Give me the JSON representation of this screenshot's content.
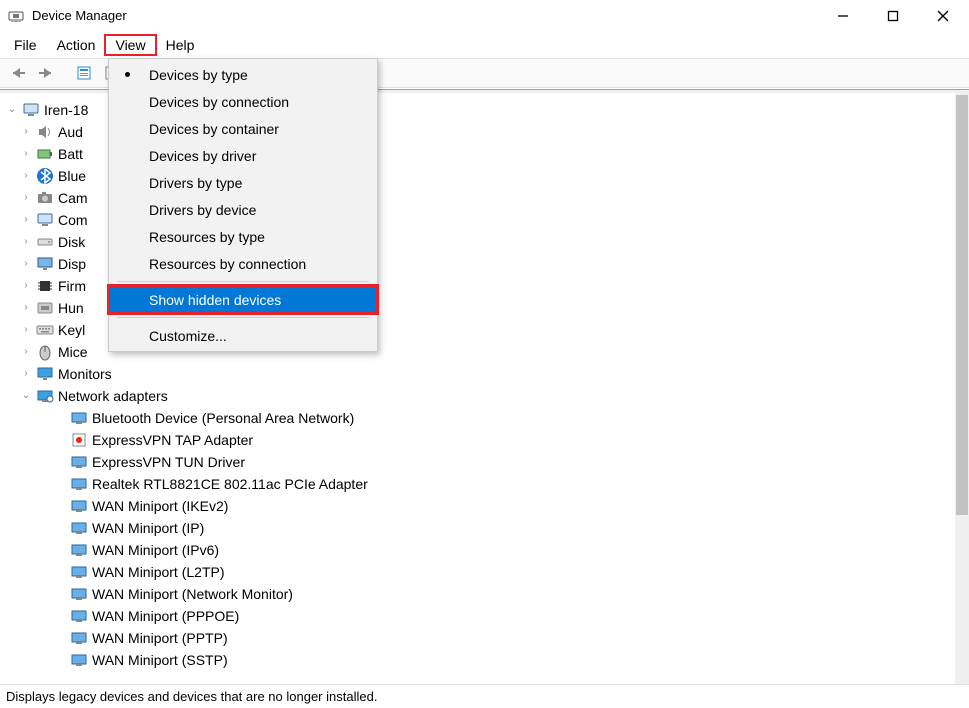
{
  "window": {
    "title": "Device Manager"
  },
  "menu": {
    "items": [
      "File",
      "Action",
      "View",
      "Help"
    ],
    "active": 2
  },
  "view_menu": {
    "items": [
      {
        "label": "Devices by type",
        "checked": true
      },
      {
        "label": "Devices by connection"
      },
      {
        "label": "Devices by container"
      },
      {
        "label": "Devices by driver"
      },
      {
        "label": "Drivers by type"
      },
      {
        "label": "Drivers by device"
      },
      {
        "label": "Resources by type"
      },
      {
        "label": "Resources by connection"
      },
      {
        "sep": true
      },
      {
        "label": "Show hidden devices",
        "selected": true
      },
      {
        "sep": true
      },
      {
        "label": "Customize..."
      }
    ]
  },
  "tree": {
    "root": "Iren-18",
    "categories": [
      {
        "label": "Aud",
        "icon": "speaker"
      },
      {
        "label": "Batt",
        "icon": "battery"
      },
      {
        "label": "Blue",
        "icon": "bluetooth"
      },
      {
        "label": "Cam",
        "icon": "camera"
      },
      {
        "label": "Com",
        "icon": "computer"
      },
      {
        "label": "Disk",
        "icon": "disk"
      },
      {
        "label": "Disp",
        "icon": "display"
      },
      {
        "label": "Firm",
        "icon": "chip"
      },
      {
        "label": "Hun",
        "icon": "hid"
      },
      {
        "label": "Keyl",
        "icon": "keyboard"
      },
      {
        "label": "Mice",
        "icon": "mouse"
      },
      {
        "label": "Monitors",
        "icon": "monitor"
      },
      {
        "label": "Network adapters",
        "icon": "network",
        "expanded": true
      }
    ],
    "network_children": [
      "Bluetooth Device (Personal Area Network)",
      "ExpressVPN TAP Adapter",
      "ExpressVPN TUN Driver",
      "Realtek RTL8821CE 802.11ac PCIe Adapter",
      "WAN Miniport (IKEv2)",
      "WAN Miniport (IP)",
      "WAN Miniport (IPv6)",
      "WAN Miniport (L2TP)",
      "WAN Miniport (Network Monitor)",
      "WAN Miniport (PPPOE)",
      "WAN Miniport (PPTP)",
      "WAN Miniport (SSTP)"
    ]
  },
  "status": "Displays legacy devices and devices that are no longer installed."
}
